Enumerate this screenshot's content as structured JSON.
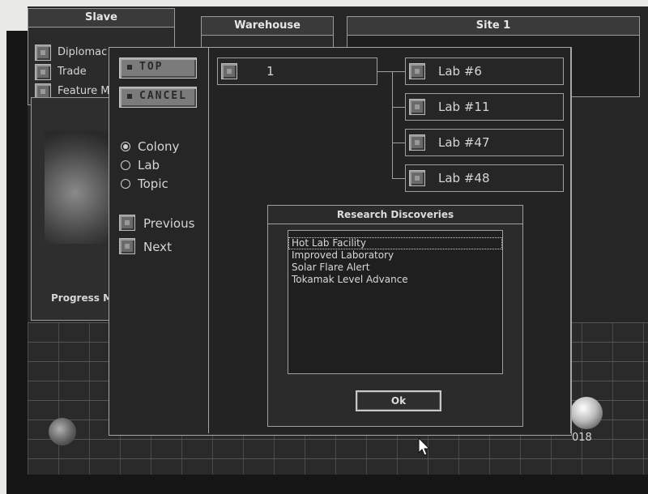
{
  "background_windows": {
    "slave": {
      "title": "Slave",
      "items": [
        "Diplomac",
        "Trade",
        "Feature M"
      ]
    },
    "warehouse": {
      "title": "Warehouse"
    },
    "site": {
      "title": "Site 1"
    },
    "progress_label": "Progress M",
    "counter": "018"
  },
  "controls": {
    "top_label": "TOP",
    "cancel_label": "CANCEL",
    "radios": [
      {
        "label": "Colony",
        "selected": true
      },
      {
        "label": "Lab",
        "selected": false
      },
      {
        "label": "Topic",
        "selected": false
      }
    ],
    "previous_label": "Previous",
    "next_label": "Next"
  },
  "tree": {
    "root_label": "1",
    "labs": [
      "Lab #6",
      "Lab #11",
      "Lab #47",
      "Lab #48"
    ]
  },
  "research_dialog": {
    "title": "Research Discoveries",
    "items": [
      "Hot Lab Facility",
      "Improved Laboratory",
      "Solar Flare Alert",
      "Tokamak Level Advance"
    ],
    "selected_index": 0,
    "ok_label": "Ok"
  }
}
